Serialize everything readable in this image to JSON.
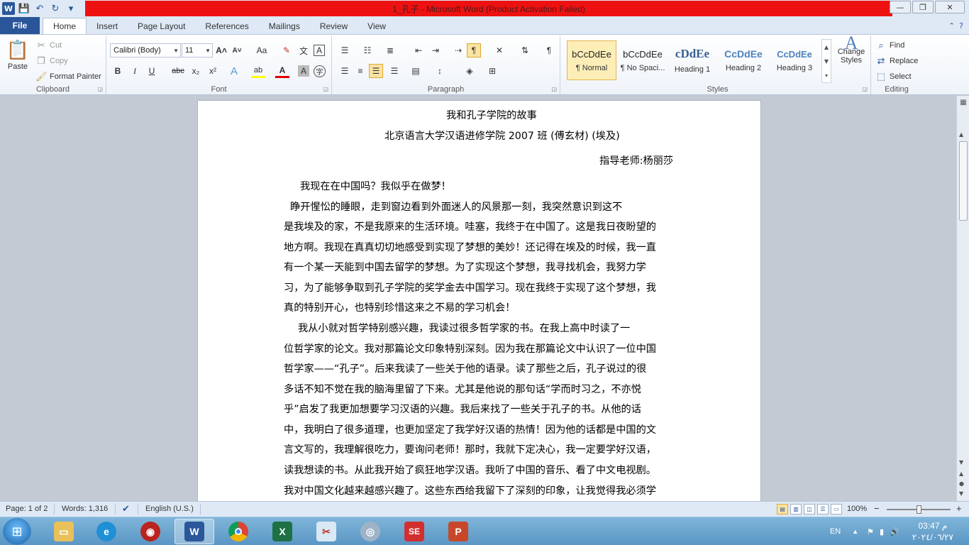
{
  "window": {
    "title": "1_孔子  - Microsoft Word (Product Activation Failed)",
    "controls": {
      "minimize": "—",
      "maximize": "❐",
      "close": "✕"
    }
  },
  "qat": {
    "word": "W",
    "save": "💾",
    "undo": "↶",
    "redo": "↻",
    "customize": "▾"
  },
  "tabs": [
    "Home",
    "Insert",
    "Page Layout",
    "References",
    "Mailings",
    "Review",
    "View"
  ],
  "file_tab": "File",
  "clipboard": {
    "label": "Clipboard",
    "paste": "Paste",
    "cut": "Cut",
    "copy": "Copy",
    "format_painter": "Format Painter"
  },
  "font": {
    "label": "Font",
    "family": "Calibri (Body)",
    "size": "11",
    "grow": "A˄",
    "shrink": "A˅",
    "case": "Aa",
    "clear": "A",
    "bold": "B",
    "italic": "I",
    "underline": "U",
    "strike": "abc",
    "sub": "x₂",
    "sup": "x²",
    "effects": "A",
    "highlight": "ab",
    "color": "A",
    "shade": "A",
    "enclose": "字"
  },
  "paragraph": {
    "label": "Paragraph",
    "pilcrow": "¶"
  },
  "styles": {
    "label": "Styles",
    "items": [
      {
        "sample": "bCcDdEe",
        "name": "¶ Normal"
      },
      {
        "sample": "bCcDdEe",
        "name": "¶ No Spaci..."
      },
      {
        "sample": "cDdEe",
        "name": "Heading 1"
      },
      {
        "sample": "CcDdEe",
        "name": "Heading 2"
      },
      {
        "sample": "CcDdEe",
        "name": "Heading 3"
      }
    ],
    "change_styles": "Change Styles",
    "colors": {
      "heading": "#365f91",
      "heading2": "#4f81bd"
    }
  },
  "editing": {
    "label": "Editing",
    "find": "Find",
    "replace": "Replace",
    "select": "Select"
  },
  "document": {
    "lines": [
      "我和孔子学院的故事",
      "北京语言大学汉语进修学院 2007 班  (傅玄材) (埃及)",
      "指导老师:杨丽莎",
      "我现在在中国吗？我似乎在做梦！",
      "睁开惺忪的睡眼，走到窗边看到外面迷人的风景那一刻，我突然意识到这不",
      "是我埃及的家，不是我原来的生活环境。哇塞，我终于在中国了。这是我日夜盼望的",
      "地方啊。我现在真真切切地感受到实现了梦想的美妙！还记得在埃及的时候，我一直",
      "有一个某一天能到中国去留学的梦想。为了实现这个梦想，我寻找机会，我努力学",
      "习，为了能够争取到孔子学院的奖学金去中国学习。现在我终于实现了这个梦想，我",
      "真的特别开心，也特别珍惜这来之不易的学习机会！",
      "我从小就对哲学特别感兴趣，我读过很多哲学家的书。在我上高中时读了一",
      "位哲学家的论文。我对那篇论文印象特别深刻。因为我在那篇论文中认识了一位中国",
      "哲学家——“孔子”。后来我读了一些关于他的语录。读了那些之后，孔子说过的很",
      "多话不知不觉在我的脑海里留了下来。尤其是他说的那句话“学而时习之，不亦悦",
      "乎”启发了我更加想要学习汉语的兴趣。我后来找了一些关于孔子的书。从他的话",
      "中，我明白了很多道理，也更加坚定了我学好汉语的热情！因为他的话都是中国的文",
      "言文写的，我理解很吃力，要询问老师！那时，我就下定决心，我一定要学好汉语，",
      "读我想读的书。从此我开始了疯狂地学汉语。我听了中国的音乐、看了中文电视剧。",
      "我对中国文化越来越感兴趣了。这些东西给我留下了深刻的印象，让我觉得我必须学"
    ]
  },
  "status": {
    "page": "Page: 1 of 2",
    "words": "Words: 1,316",
    "language": "English (U.S.)",
    "zoom": "100%",
    "zoom_minus": "−",
    "zoom_plus": "+"
  },
  "taskbar": {
    "lang": "EN",
    "time": "03:47 م",
    "date": "٢٠٢٤/٠٦/٢٧"
  }
}
